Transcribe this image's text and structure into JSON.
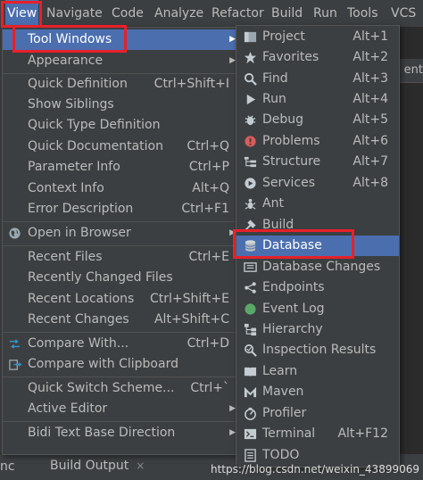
{
  "menubar": {
    "items": [
      "View",
      "Navigate",
      "Code",
      "Analyze",
      "Refactor",
      "Build",
      "Run",
      "Tools",
      "VCS"
    ]
  },
  "view_menu": {
    "items": [
      {
        "label": "Tool Windows",
        "shortcut": "",
        "submenu": true,
        "selected": true
      },
      {
        "label": "Appearance",
        "shortcut": "",
        "submenu": true
      },
      {
        "label": "Quick Definition",
        "shortcut": "Ctrl+Shift+I"
      },
      {
        "label": "Show Siblings",
        "shortcut": ""
      },
      {
        "label": "Quick Type Definition",
        "shortcut": ""
      },
      {
        "label": "Quick Documentation",
        "shortcut": "Ctrl+Q"
      },
      {
        "label": "Parameter Info",
        "shortcut": "Ctrl+P"
      },
      {
        "label": "Context Info",
        "shortcut": "Alt+Q"
      },
      {
        "label": "Error Description",
        "shortcut": "Ctrl+F1"
      },
      {
        "label": "Open in Browser",
        "shortcut": "",
        "submenu": true,
        "icon": "globe-icon"
      },
      {
        "label": "Recent Files",
        "shortcut": "Ctrl+E"
      },
      {
        "label": "Recently Changed Files",
        "shortcut": ""
      },
      {
        "label": "Recent Locations",
        "shortcut": "Ctrl+Shift+E"
      },
      {
        "label": "Recent Changes",
        "shortcut": "Alt+Shift+C"
      },
      {
        "label": "Compare With...",
        "shortcut": "Ctrl+D",
        "icon": "compare-icon"
      },
      {
        "label": "Compare with Clipboard",
        "shortcut": "",
        "icon": "compare-clipboard-icon"
      },
      {
        "label": "Quick Switch Scheme...",
        "shortcut": "Ctrl+`"
      },
      {
        "label": "Active Editor",
        "shortcut": "",
        "submenu": true
      },
      {
        "label": "Bidi Text Base Direction",
        "shortcut": "",
        "submenu": true
      }
    ]
  },
  "tool_windows_menu": {
    "items": [
      {
        "label": "Project",
        "shortcut": "Alt+1",
        "icon": "project-icon"
      },
      {
        "label": "Favorites",
        "shortcut": "Alt+2",
        "icon": "star-icon"
      },
      {
        "label": "Find",
        "shortcut": "Alt+3",
        "icon": "find-icon"
      },
      {
        "label": "Run",
        "shortcut": "Alt+4",
        "icon": "run-icon"
      },
      {
        "label": "Debug",
        "shortcut": "Alt+5",
        "icon": "debug-icon"
      },
      {
        "label": "Problems",
        "shortcut": "Alt+6",
        "icon": "problems-icon"
      },
      {
        "label": "Structure",
        "shortcut": "Alt+7",
        "icon": "structure-icon"
      },
      {
        "label": "Services",
        "shortcut": "Alt+8",
        "icon": "services-icon"
      },
      {
        "label": "Ant",
        "shortcut": "",
        "icon": "ant-icon"
      },
      {
        "label": "Build",
        "shortcut": "",
        "icon": "build-icon"
      },
      {
        "label": "Database",
        "shortcut": "",
        "icon": "database-icon",
        "selected": true
      },
      {
        "label": "Database Changes",
        "shortcut": "",
        "icon": "database-changes-icon"
      },
      {
        "label": "Endpoints",
        "shortcut": "",
        "icon": "endpoints-icon"
      },
      {
        "label": "Event Log",
        "shortcut": "",
        "icon": "event-log-icon"
      },
      {
        "label": "Hierarchy",
        "shortcut": "",
        "icon": "hierarchy-icon"
      },
      {
        "label": "Inspection Results",
        "shortcut": "",
        "icon": "inspection-icon"
      },
      {
        "label": "Learn",
        "shortcut": "",
        "icon": "learn-icon"
      },
      {
        "label": "Maven",
        "shortcut": "",
        "icon": "maven-icon"
      },
      {
        "label": "Profiler",
        "shortcut": "",
        "icon": "profiler-icon"
      },
      {
        "label": "Terminal",
        "shortcut": "Alt+F12",
        "icon": "terminal-icon"
      },
      {
        "label": "TODO",
        "shortcut": "",
        "icon": "todo-icon"
      }
    ]
  },
  "background": {
    "editor_tab_fragment": "ent",
    "bottom_left_fragment": "nc",
    "bottom_tab": "Build Output",
    "bottom_tab_close": "×"
  },
  "watermark": "https://blog.csdn.net/weixin_43899069",
  "colors": {
    "menu_bg": "#3c3f41",
    "selection": "#4b6eaf",
    "highlight_box": "#e8202a",
    "text": "#bbbbbb"
  }
}
